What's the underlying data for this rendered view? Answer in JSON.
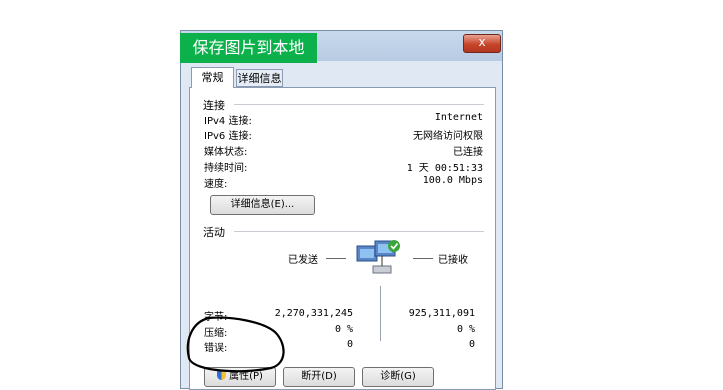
{
  "banner": "保存图片到本地",
  "close_glyph": "x",
  "tabs": {
    "general": "常规",
    "details": "详细信息"
  },
  "connection": {
    "title": "连接",
    "rows": [
      {
        "label": "IPv4 连接:",
        "value": "Internet"
      },
      {
        "label": "IPv6 连接:",
        "value": "无网络访问权限"
      },
      {
        "label": "媒体状态:",
        "value": "已连接"
      },
      {
        "label": "持续时间:",
        "value": "1 天 00:51:33"
      },
      {
        "label": "速度:",
        "value": "100.0 Mbps"
      }
    ],
    "details_button": "详细信息(E)..."
  },
  "activity": {
    "title": "活动",
    "sent_label": "已发送",
    "received_label": "已接收",
    "rows": [
      {
        "label": "字节:",
        "sent": "2,270,331,245",
        "received": "925,311,091"
      },
      {
        "label": "压缩:",
        "sent": "0 %",
        "received": "0 %"
      },
      {
        "label": "错误:",
        "sent": "0",
        "received": "0"
      }
    ]
  },
  "buttons": {
    "properties": "属性(P)",
    "disable": "断开(D)",
    "diagnose": "诊断(G)"
  },
  "colors": {
    "banner_bg": "#0db14b",
    "annotation_ink": "#000000"
  }
}
